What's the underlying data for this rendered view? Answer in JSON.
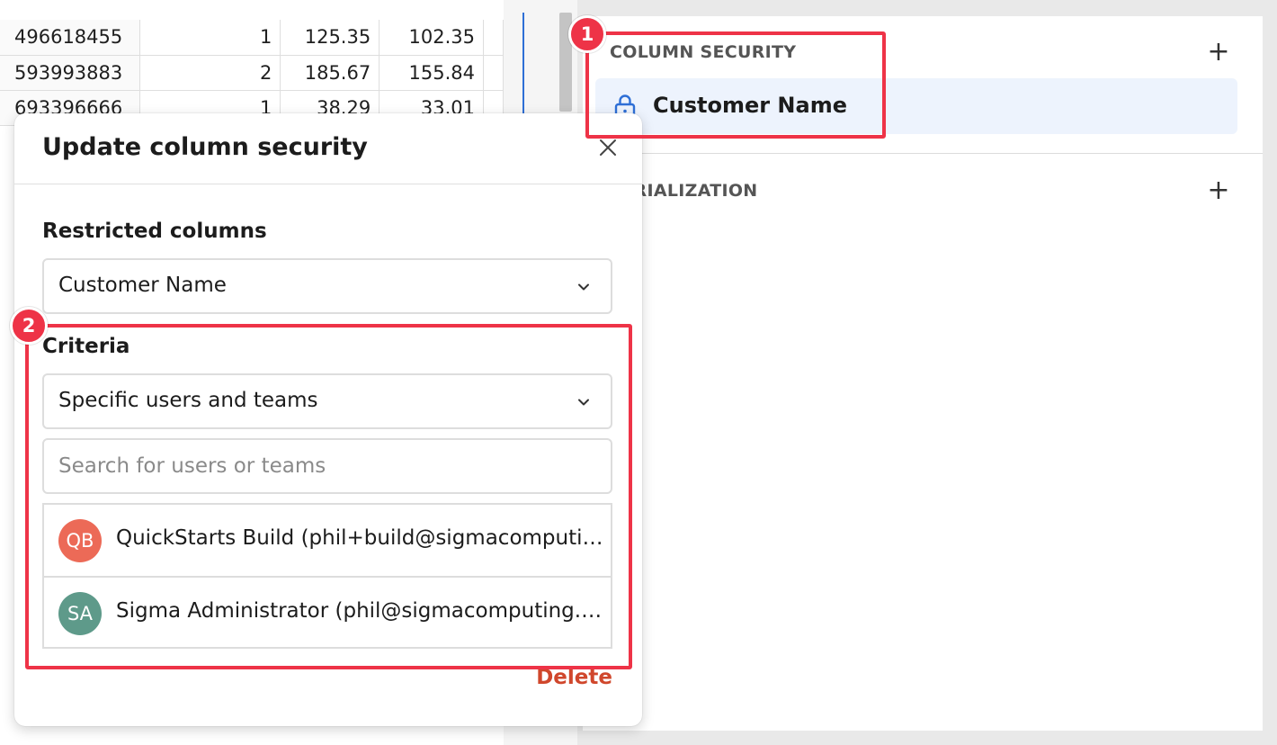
{
  "table": {
    "rows": [
      {
        "id": "496618455",
        "qty": "1",
        "a": "125.35",
        "b": "102.35"
      },
      {
        "id": "593993883",
        "qty": "2",
        "a": "185.67",
        "b": "155.84"
      },
      {
        "id": "693396666",
        "qty": "1",
        "a": "38.29",
        "b": "33.01"
      }
    ]
  },
  "panel": {
    "column_security_header": "COLUMN SECURITY",
    "column_security_item": "Customer Name",
    "materialization_header": "TERIALIZATION",
    "add_glyph": "+"
  },
  "modal": {
    "title": "Update column security",
    "restricted_columns_label": "Restricted columns",
    "restricted_columns_value": "Customer Name",
    "criteria_label": "Criteria",
    "criteria_value": "Specific users and teams",
    "search_placeholder": "Search for users or teams",
    "users": [
      {
        "initials": "QB",
        "name": "QuickStarts Build (phil+build@sigmacomputing.com)",
        "color": "#ec6a57"
      },
      {
        "initials": "SA",
        "name": "Sigma Administrator (phil@sigmacomputing.com)",
        "color": "#5e9a8a"
      }
    ],
    "delete_label": "Delete"
  },
  "callouts": {
    "one": "1",
    "two": "2"
  },
  "colors": {
    "accent": "#ee3347",
    "lock_icon": "#2e6fd6",
    "delete": "#d0472c"
  }
}
